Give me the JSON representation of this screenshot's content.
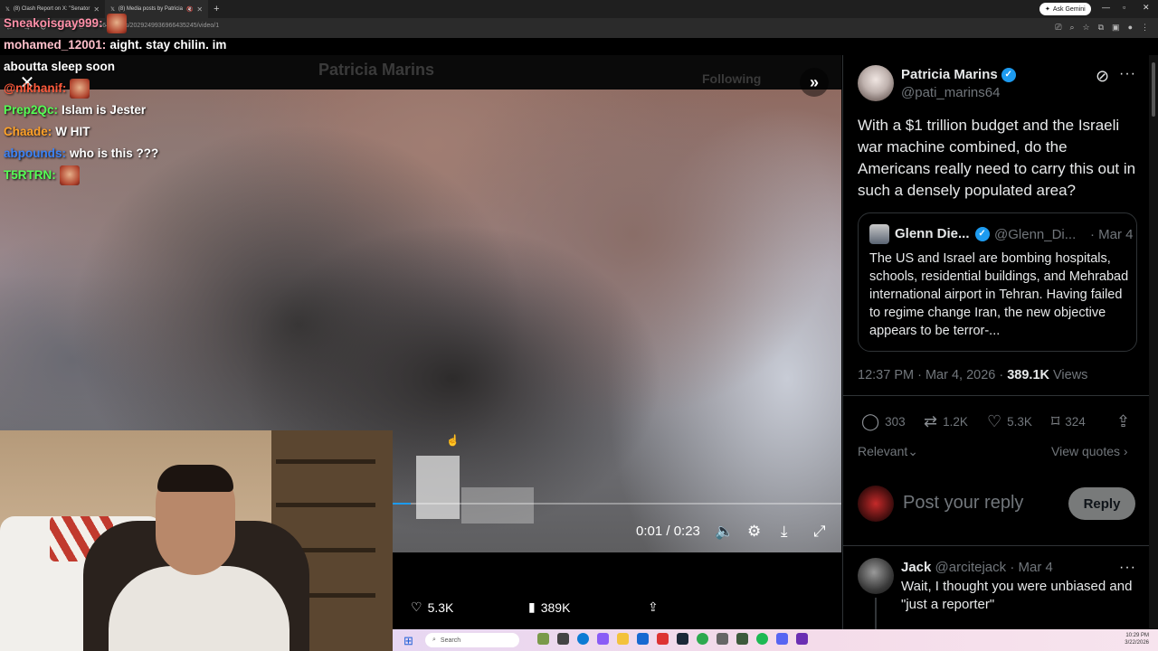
{
  "browser": {
    "tabs": [
      {
        "label": "(8) Clash Report on X: \"Senator"
      },
      {
        "label": "(8) Media posts by Patricia"
      }
    ],
    "url": ".com/pati_marins64/status/2029249936966435245/video/1",
    "ask_gemini": "Ask Gemini"
  },
  "chat": [
    {
      "user": "Sneakoisgay999:",
      "color": "#ff8fa8",
      "text": "",
      "emote": true
    },
    {
      "user": "mohamed_12001:",
      "color": "#ffc0cb",
      "text": "aight. stay chilin. im",
      "emote": false
    },
    {
      "user": "",
      "color": "#ffffff",
      "text": "aboutta sleep soon",
      "emote": false
    },
    {
      "user": "@nikhanif:",
      "color": "#ff5a3c",
      "text": "",
      "emote": true
    },
    {
      "user": "Prep2Qc:",
      "color": "#55ff55",
      "text": "Islam is Jester",
      "emote": false
    },
    {
      "user": "Chaade:",
      "color": "#ffa229",
      "text": "W HIT",
      "emote": false
    },
    {
      "user": "abpounds:",
      "color": "#3b82f6",
      "text": "who is this ???",
      "emote": false
    },
    {
      "user": "T5RTRN:",
      "color": "#55ff55",
      "text": "",
      "emote": true
    }
  ],
  "background_page": {
    "name": "Patricia Marins",
    "follow_label": "Following"
  },
  "video": {
    "time": "0:01 / 0:23",
    "progress": 0.04,
    "likes": "5.3K",
    "views": "389K"
  },
  "tweet": {
    "author": "Patricia Marins",
    "handle": "@pati_marins64",
    "text": "With a $1 trillion budget and the Israeli war machine combined, do the Americans really need to carry this out in such a densely populated area?",
    "quote": {
      "author": "Glenn Die...",
      "handle": "@Glenn_Di...",
      "date": "· Mar 4",
      "text": "The US and Israel are bombing hospitals, schools, residential buildings, and Mehrabad international airport in Tehran. Having failed to regime change Iran, the new objective appears to be terror-..."
    },
    "meta_time": "12:37 PM · Mar 4, 2026 · ",
    "meta_views": "389.1K",
    "meta_views_label": " Views",
    "stats": {
      "replies": "303",
      "reposts": "1.2K",
      "likes": "5.3K",
      "bookmarks": "324"
    },
    "sort_label": "Relevant",
    "view_quotes": "View quotes",
    "reply_placeholder": "Post your reply",
    "reply_button": "Reply"
  },
  "reply": {
    "author": "Jack",
    "handle": "@arcitejack",
    "date": "· Mar 4",
    "text": "Wait, I thought you were unbiased and \"just a reporter\""
  },
  "taskbar": {
    "search_placeholder": "Search",
    "time": "10:29 PM",
    "date": "3/22/2026"
  }
}
